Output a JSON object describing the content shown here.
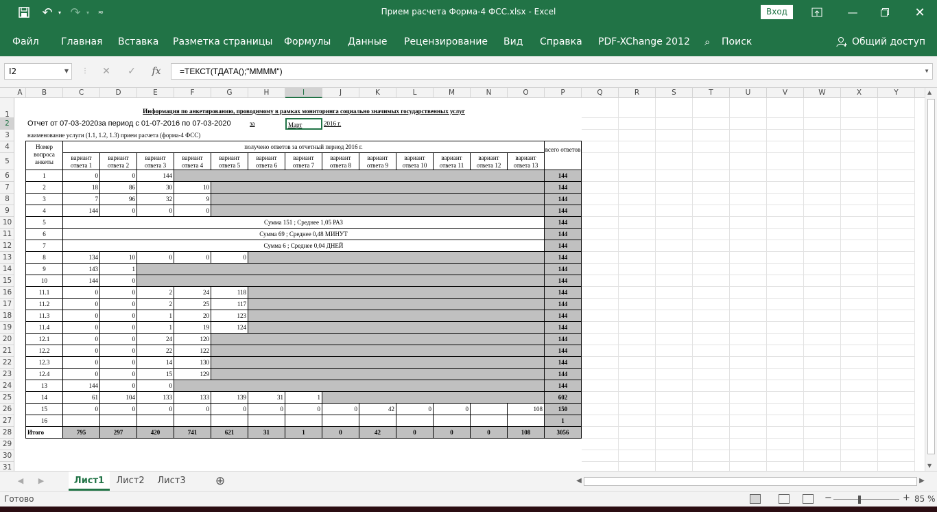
{
  "window": {
    "title": "Прием расчета Форма-4 ФСС.xlsx  -  Excel",
    "login": "Вход"
  },
  "ribbon": {
    "tabs": [
      "Файл",
      "Главная",
      "Вставка",
      "Разметка страницы",
      "Формулы",
      "Данные",
      "Рецензирование",
      "Вид",
      "Справка",
      "PDF-XChange 2012"
    ],
    "search": "Поиск",
    "share": "Общий доступ"
  },
  "formula_bar": {
    "name_box": "I2",
    "formula": "=ТЕКСТ(ТДАТА();\"ММММ\")"
  },
  "columns": [
    "A",
    "B",
    "C",
    "D",
    "E",
    "F",
    "G",
    "H",
    "I",
    "J",
    "K",
    "L",
    "M",
    "N",
    "O",
    "P",
    "Q",
    "R",
    "S",
    "T",
    "U",
    "V",
    "W",
    "X",
    "Y"
  ],
  "rows": [
    "1",
    "2",
    "3",
    "4",
    "5",
    "6",
    "7",
    "8",
    "9",
    "10",
    "11",
    "12",
    "13",
    "14",
    "15",
    "16",
    "17",
    "18",
    "19",
    "20",
    "21",
    "22",
    "23",
    "24",
    "25",
    "26",
    "27",
    "28",
    "29",
    "30",
    "31"
  ],
  "sheet": {
    "heading": "Информация по анкетированию, проводимому в рамках мониторинга социально значимых государственных услуг",
    "report_line": "Отчет от 07-03-2020за период с 01-07-2016  по  07-03-2020",
    "za": "за",
    "month": "Март",
    "year": "2016 г.",
    "service": "наименование услуги (1.1,  1.2,  1.3) прием расчета (форма-4 ФСС)",
    "q_header": "Номер вопроса анкеты",
    "received": "получено ответов за отчетный период 2016 г.",
    "variants": [
      "вариант ответа 1",
      "вариант ответа 2",
      "вариант ответа 3",
      "вариант ответа 4",
      "вариант ответа 5",
      "вариант ответа 6",
      "вариант ответа 7",
      "вариант ответа 8",
      "вариант ответа 9",
      "вариант ответа 10",
      "вариант ответа 11",
      "вариант ответа 12",
      "вариант ответа 13"
    ],
    "total_header": "всего ответов",
    "rows": [
      {
        "q": "1",
        "vals": [
          "0",
          "0",
          "144"
        ],
        "gray_from": 3,
        "total": "144"
      },
      {
        "q": "2",
        "vals": [
          "18",
          "86",
          "30",
          "10"
        ],
        "gray_from": 4,
        "total": "144"
      },
      {
        "q": "3",
        "vals": [
          "7",
          "96",
          "32",
          "9"
        ],
        "gray_from": 4,
        "total": "144"
      },
      {
        "q": "4",
        "vals": [
          "144",
          "0",
          "0",
          "0"
        ],
        "gray_from": 4,
        "total": "144"
      },
      {
        "q": "5",
        "merged": "Сумма 151 ;  Среднее 1,05 РАЗ",
        "total": "144"
      },
      {
        "q": "6",
        "merged": "Сумма 69 ;  Среднее 0,48 МИНУТ",
        "total": "144"
      },
      {
        "q": "7",
        "merged": "Сумма 6 ;  Среднее 0,04 ДНЕЙ",
        "total": "144"
      },
      {
        "q": "8",
        "vals": [
          "134",
          "10",
          "0",
          "0",
          "0"
        ],
        "gray_from": 5,
        "total": "144"
      },
      {
        "q": "9",
        "vals": [
          "143",
          "1"
        ],
        "gray_from": 2,
        "total": "144"
      },
      {
        "q": "10",
        "vals": [
          "144",
          "0"
        ],
        "gray_from": 2,
        "total": "144"
      },
      {
        "q": "11.1",
        "vals": [
          "0",
          "0",
          "2",
          "24",
          "118"
        ],
        "gray_from": 5,
        "total": "144"
      },
      {
        "q": "11.2",
        "vals": [
          "0",
          "0",
          "2",
          "25",
          "117"
        ],
        "gray_from": 5,
        "total": "144"
      },
      {
        "q": "11.3",
        "vals": [
          "0",
          "0",
          "1",
          "20",
          "123"
        ],
        "gray_from": 5,
        "total": "144"
      },
      {
        "q": "11.4",
        "vals": [
          "0",
          "0",
          "1",
          "19",
          "124"
        ],
        "gray_from": 5,
        "total": "144"
      },
      {
        "q": "12.1",
        "vals": [
          "0",
          "0",
          "24",
          "120"
        ],
        "gray_from": 4,
        "total": "144"
      },
      {
        "q": "12.2",
        "vals": [
          "0",
          "0",
          "22",
          "122"
        ],
        "gray_from": 4,
        "total": "144"
      },
      {
        "q": "12.3",
        "vals": [
          "0",
          "0",
          "14",
          "130"
        ],
        "gray_from": 4,
        "total": "144"
      },
      {
        "q": "12.4",
        "vals": [
          "0",
          "0",
          "15",
          "129"
        ],
        "gray_from": 4,
        "total": "144"
      },
      {
        "q": "13",
        "vals": [
          "144",
          "0",
          "0"
        ],
        "gray_from": 3,
        "total": "144"
      },
      {
        "q": "14",
        "vals": [
          "61",
          "104",
          "133",
          "133",
          "139",
          "31",
          "1"
        ],
        "gray_from": 7,
        "total": "602"
      },
      {
        "q": "15",
        "vals": [
          "0",
          "0",
          "0",
          "0",
          "0",
          "0",
          "0",
          "0",
          "42",
          "0",
          "0",
          "",
          "108"
        ],
        "gray_from": 13,
        "total": "150"
      },
      {
        "q": "16",
        "vals": [],
        "gray_from": 13,
        "total": "1"
      }
    ],
    "total_row": {
      "label": "Итого",
      "vals": [
        "795",
        "297",
        "420",
        "741",
        "621",
        "31",
        "1",
        "0",
        "42",
        "0",
        "0",
        "0",
        "108"
      ],
      "total": "3056"
    }
  },
  "sheet_tabs": [
    "Лист1",
    "Лист2",
    "Лист3"
  ],
  "status": {
    "ready": "Готово",
    "zoom": "85 %"
  },
  "colors": {
    "accent": "#217346",
    "gray_cell": "#c0c0c0"
  }
}
